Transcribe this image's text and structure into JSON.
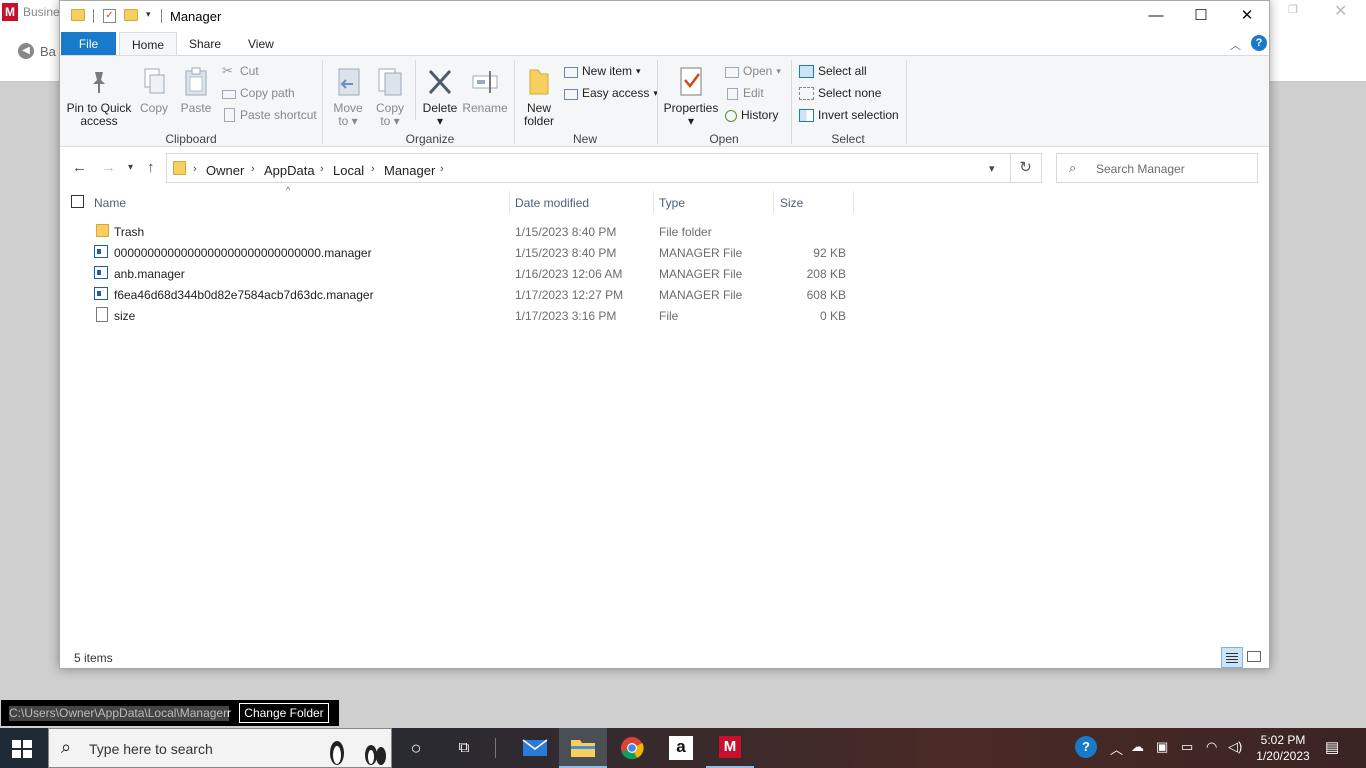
{
  "background_app": {
    "title": "Busine",
    "logo_letter": "M",
    "back_label": "Ba"
  },
  "window": {
    "title": "Manager",
    "minimize": "—",
    "maximize": "☐",
    "close": "✕"
  },
  "ribbon_tabs": [
    "File",
    "Home",
    "Share",
    "View"
  ],
  "ribbon": {
    "clipboard": {
      "label": "Clipboard",
      "pin": "Pin to Quick access",
      "pin_l1": "Pin to Quick",
      "pin_l2": "access",
      "copy": "Copy",
      "paste": "Paste",
      "cut": "Cut",
      "copy_path": "Copy path",
      "paste_shortcut": "Paste shortcut"
    },
    "organize": {
      "label": "Organize",
      "move_to_l1": "Move",
      "move_to_l2": "to",
      "copy_to_l1": "Copy",
      "copy_to_l2": "to",
      "delete": "Delete",
      "rename": "Rename"
    },
    "new": {
      "label": "New",
      "new_folder_l1": "New",
      "new_folder_l2": "folder",
      "new_item": "New item",
      "easy_access": "Easy access"
    },
    "open": {
      "label": "Open",
      "properties": "Properties",
      "open": "Open",
      "edit": "Edit",
      "history": "History"
    },
    "select": {
      "label": "Select",
      "select_all": "Select all",
      "select_none": "Select none",
      "invert_selection": "Invert selection"
    }
  },
  "address": {
    "crumbs": [
      "Owner",
      "AppData",
      "Local",
      "Manager"
    ],
    "search_placeholder": "Search Manager"
  },
  "columns": {
    "name": "Name",
    "date": "Date modified",
    "type": "Type",
    "size": "Size"
  },
  "files": [
    {
      "name": "Trash",
      "date": "1/15/2023 8:40 PM",
      "type": "File folder",
      "size": "",
      "icon": "folder-icon"
    },
    {
      "name": "0000000000000000000000000000000.manager",
      "date": "1/15/2023 8:40 PM",
      "type": "MANAGER File",
      "size": "92 KB",
      "icon": "manager-file-icon"
    },
    {
      "name": "anb.manager",
      "date": "1/16/2023 12:06 AM",
      "type": "MANAGER File",
      "size": "208 KB",
      "icon": "manager-file-icon"
    },
    {
      "name": "f6ea46d68d344b0d82e7584acb7d63dc.manager",
      "date": "1/17/2023 12:27 PM",
      "type": "MANAGER File",
      "size": "608 KB",
      "icon": "manager-file-icon"
    },
    {
      "name": "size",
      "date": "1/17/2023 3:16 PM",
      "type": "File",
      "size": "0 KB",
      "icon": "file-icon"
    }
  ],
  "status": {
    "items": "5 items"
  },
  "path_bar": {
    "path": "C:\\Users\\Owner\\AppData\\Local\\Manager",
    "change_folder": "Change Folder"
  },
  "taskbar": {
    "search_placeholder": "Type here to search",
    "time": "5:02 PM",
    "date": "1/20/2023",
    "app_letter": "M",
    "amazon_letter": "a"
  },
  "colors": {
    "accent": "#1979ca",
    "manager_red": "#c8102e",
    "folder": "#f6cf5f"
  }
}
